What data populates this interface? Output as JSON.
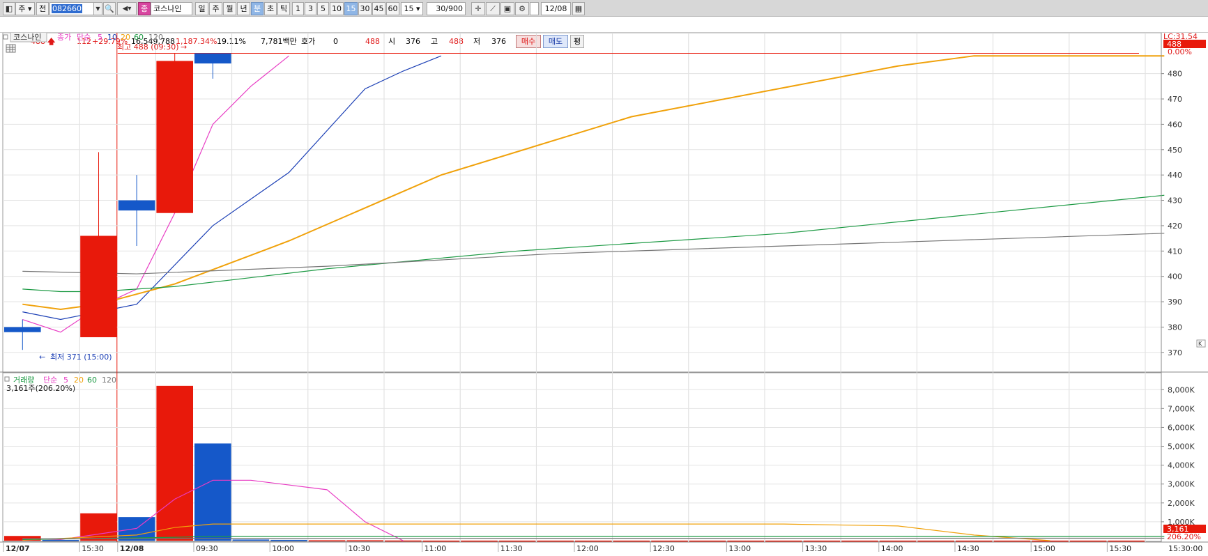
{
  "toolbar": {
    "period_main": "주",
    "prev_label": "전",
    "code": "082660",
    "stock_badge": "종",
    "stock_name": "코스나인",
    "periods": [
      "일",
      "주",
      "월",
      "년",
      "분",
      "초",
      "틱"
    ],
    "minutes": [
      "1",
      "3",
      "5",
      "10",
      "15",
      "30",
      "45",
      "60"
    ],
    "minute_select": "15",
    "count": "30/900",
    "date": "12/08"
  },
  "quote": {
    "price": "488",
    "change": "112",
    "change_pct": "+29.79%",
    "volume": "16,549,788",
    "volume_pct": "1,187.34%",
    "turnover_pct": "19.11%",
    "amount": "7,781백만",
    "hoga_label": "호가",
    "hoga_value": "0",
    "hoga_price": "488",
    "open_label": "시",
    "open": "376",
    "high_label": "고",
    "high": "488",
    "low_label": "저",
    "low": "376",
    "buy_label": "매수",
    "sell_label": "매도",
    "avg_label": "평"
  },
  "price_legend": {
    "name": "코스나인",
    "price_type": "종가",
    "ma_type": "단순",
    "periods": [
      "5",
      "10",
      "20",
      "60",
      "120"
    ]
  },
  "volume_legend": {
    "name": "거래량",
    "ma_type": "단순",
    "periods": [
      "5",
      "20",
      "60",
      "120"
    ],
    "current": "3,161주(206.20%)"
  },
  "annotations": {
    "high_note": "최고 488 (09:30)",
    "low_note": "최저 371 (15:00)",
    "lc_label": "LC:31.54",
    "price_tag": "488",
    "price_tag_pct": "0.00%",
    "volume_tag": "3,161",
    "volume_tag_pct": "206.20%",
    "volume_unit_icon": "K"
  },
  "colors": {
    "up": "#e8190b",
    "down": "#1558c9",
    "ma5": "#e83cc4",
    "ma10": "#1b3fb5",
    "ma20": "#f0a10a",
    "ma60": "#1d9a44",
    "ma120": "#777777"
  },
  "chart_data": [
    {
      "type": "candlestick",
      "title": "코스나인",
      "x": [
        "12/07 15:15",
        "12/07 15:30",
        "12/08 09:00",
        "12/08 09:15",
        "12/08 09:30",
        "12/08 09:45"
      ],
      "open": [
        380,
        null,
        376,
        430,
        425,
        488
      ],
      "high": [
        383,
        null,
        449,
        440,
        488,
        488
      ],
      "low": [
        371,
        null,
        376,
        412,
        425,
        478
      ],
      "close": [
        378,
        null,
        416,
        426,
        485,
        484
      ],
      "ylim": [
        365,
        492
      ],
      "yticks": [
        370,
        380,
        390,
        400,
        410,
        420,
        430,
        440,
        450,
        460,
        470,
        480
      ],
      "moving_averages": [
        {
          "name": "5",
          "values": [
            [
              0,
              383
            ],
            [
              1,
              378
            ],
            [
              2,
              388
            ],
            [
              3,
              395
            ],
            [
              4,
              425
            ],
            [
              5,
              460
            ],
            [
              6,
              475
            ],
            [
              7,
              487
            ]
          ]
        },
        {
          "name": "10",
          "values": [
            [
              0,
              386
            ],
            [
              1,
              383
            ],
            [
              3,
              389
            ],
            [
              5,
              420
            ],
            [
              7,
              441
            ],
            [
              9,
              474
            ],
            [
              10,
              481
            ],
            [
              11,
              487
            ]
          ]
        },
        {
          "name": "20",
          "values": [
            [
              0,
              389
            ],
            [
              1,
              387
            ],
            [
              2,
              389
            ],
            [
              4,
              397
            ],
            [
              7,
              414
            ],
            [
              11,
              440
            ],
            [
              16,
              463
            ],
            [
              23,
              483
            ],
            [
              25,
              487
            ],
            [
              30,
              487
            ]
          ]
        },
        {
          "name": "60",
          "values": [
            [
              0,
              395
            ],
            [
              1,
              394
            ],
            [
              2,
              394
            ],
            [
              4,
              396
            ],
            [
              8,
              403
            ],
            [
              13,
              410
            ],
            [
              20,
              417
            ],
            [
              30,
              432
            ]
          ]
        },
        {
          "name": "120",
          "values": [
            [
              0,
              402
            ],
            [
              3,
              401
            ],
            [
              8,
              404
            ],
            [
              14,
              409
            ],
            [
              22,
              413
            ],
            [
              30,
              417
            ]
          ]
        }
      ],
      "high_marker": {
        "label": "최고 488 (09:30)",
        "value": 488
      },
      "low_marker": {
        "label": "최저 371 (15:00)",
        "value": 371
      }
    },
    {
      "type": "bar",
      "title": "거래량",
      "x_ticks": [
        "12/07",
        "15:30",
        "12/08",
        "09:30",
        "10:00",
        "10:30",
        "11:00",
        "11:30",
        "12:00",
        "12:30",
        "13:00",
        "13:30",
        "14:00",
        "14:30",
        "15:00",
        "15:30",
        "15:30:00"
      ],
      "values_k": [
        250,
        40,
        1450,
        1250,
        8200,
        5150,
        60,
        40,
        20,
        20,
        10,
        5,
        5,
        5,
        5,
        5,
        5,
        5,
        5,
        5,
        5,
        5,
        5,
        5,
        5,
        5,
        5,
        5,
        5,
        5
      ],
      "bar_colors": [
        "up",
        "down",
        "up",
        "down",
        "up",
        "down",
        "down",
        "down",
        "up",
        "up",
        "up",
        "up",
        "up",
        "up",
        "up",
        "up",
        "up",
        "up",
        "up",
        "up",
        "up",
        "up",
        "up",
        "up",
        "up",
        "up",
        "up",
        "up",
        "up",
        "up"
      ],
      "ylim": [
        0,
        8600
      ],
      "yticks": [
        "1,000K",
        "2,000K",
        "3,000K",
        "4,000K",
        "5,000K",
        "6,000K",
        "7,000K",
        "8,000K"
      ],
      "moving_averages": [
        {
          "name": "5",
          "values": [
            [
              0,
              100
            ],
            [
              1,
              60
            ],
            [
              2,
              350
            ],
            [
              3,
              650
            ],
            [
              4,
              2200
            ],
            [
              5,
              3200
            ],
            [
              6,
              3200
            ],
            [
              7,
              2950
            ],
            [
              8,
              2700
            ],
            [
              9,
              1000
            ],
            [
              10,
              0
            ]
          ]
        },
        {
          "name": "20",
          "values": [
            [
              0,
              30
            ],
            [
              3,
              300
            ],
            [
              4,
              700
            ],
            [
              5,
              880
            ],
            [
              10,
              880
            ],
            [
              20,
              880
            ],
            [
              23,
              780
            ],
            [
              25,
              300
            ],
            [
              27,
              0
            ]
          ]
        },
        {
          "name": "60",
          "values": [
            [
              0,
              60
            ],
            [
              4,
              180
            ],
            [
              5,
              230
            ],
            [
              30,
              230
            ]
          ]
        },
        {
          "name": "120",
          "values": [
            [
              0,
              100
            ],
            [
              5,
              120
            ],
            [
              30,
              130
            ]
          ]
        }
      ]
    }
  ]
}
